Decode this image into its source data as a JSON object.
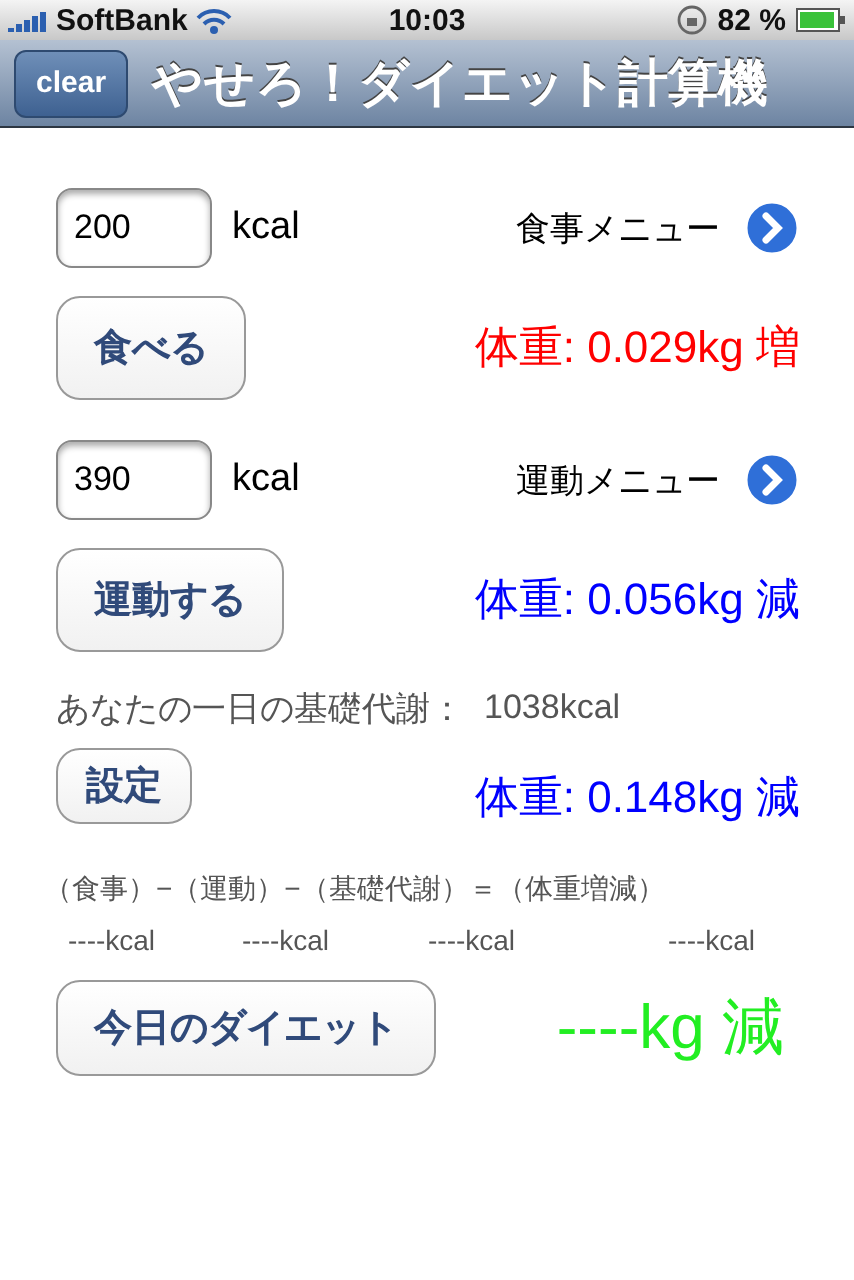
{
  "status_bar": {
    "carrier": "SoftBank",
    "time": "10:03",
    "battery": "82 %"
  },
  "nav_bar": {
    "button": "clear",
    "title": "やせろ！ダイエット計算機"
  },
  "entries": [
    {
      "value": "200",
      "unit": "kcal",
      "menu": "食事メニュー",
      "button": "食べる",
      "result": "体重: 0.029kg 増",
      "color": "#ff0000"
    },
    {
      "value": "390",
      "unit": "kcal",
      "menu": "運動メニュー",
      "button": "運動する",
      "result": "体重: 0.056kg 減",
      "color": "#0000ff"
    }
  ],
  "basal": {
    "label": "あなたの一日の基礎代謝：",
    "value": "1038kcal",
    "button": "設定",
    "result": "体重: 0.148kg 減",
    "color": "#0000ff"
  },
  "formula": "（食事）−（運動）−（基礎代謝）＝（体重増減）",
  "formula_values": [
    "----kcal",
    "----kcal",
    "----kcal",
    "----kcal"
  ],
  "summary": {
    "button": "今日のダイエット",
    "result": "----kg 減",
    "color": "#22ee22"
  }
}
